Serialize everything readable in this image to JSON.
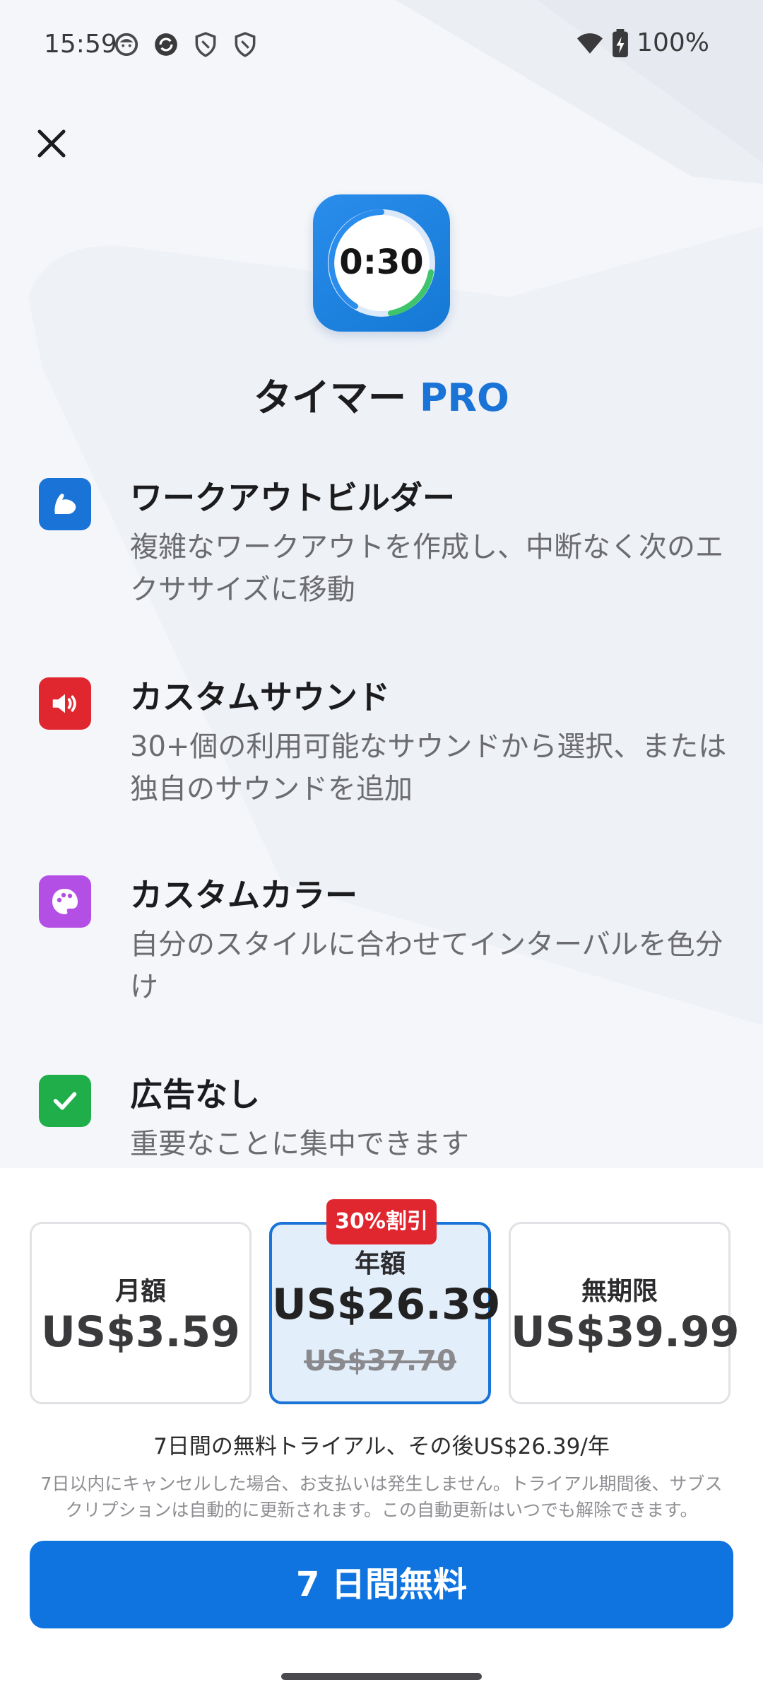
{
  "status_bar": {
    "time": "15:59",
    "battery_text": "100%",
    "left_icons": [
      "face-icon",
      "sync-icon",
      "shield-icon",
      "shield-icon"
    ],
    "right_icons": [
      "wifi-icon",
      "battery-charging-icon"
    ]
  },
  "header": {
    "app_icon_clock": "0:30",
    "title_main": "タイマー",
    "title_accent": "PRO"
  },
  "features": [
    {
      "icon": "muscle-icon",
      "color": "#1a73d6",
      "title": "ワークアウトビルダー",
      "desc": "複雑なワークアウトを作成し、中断なく次のエクササイズに移動"
    },
    {
      "icon": "speaker-icon",
      "color": "#e0262e",
      "title": "カスタムサウンド",
      "desc": "30+個の利用可能なサウンドから選択、または独自のサウンドを追加"
    },
    {
      "icon": "palette-icon",
      "color": "#b44fe6",
      "title": "カスタムカラー",
      "desc": "自分のスタイルに合わせてインターバルを色分け"
    },
    {
      "icon": "check-icon",
      "color": "#1fae4a",
      "title": "広告なし",
      "desc": "重要なことに集中できます"
    }
  ],
  "plans": [
    {
      "name": "月額",
      "price": "US$3.59"
    },
    {
      "name": "年額",
      "price": "US$26.39",
      "old_price": "US$37.70",
      "badge": "30%割引",
      "selected": true
    },
    {
      "name": "無期限",
      "price": "US$39.99"
    }
  ],
  "trial_line": "7日間の無料トライアル、その後US$26.39/年",
  "fine_print": "7日以内にキャンセルした場合、お支払いは発生しません。トライアル期間後、サブスクリプションは自動的に更新されます。この自動更新はいつでも解除できます。",
  "cta_label": "7 日間無料",
  "colors": {
    "accent": "#1a73d6",
    "badge": "#e0262e",
    "cta": "#0f74e0"
  }
}
